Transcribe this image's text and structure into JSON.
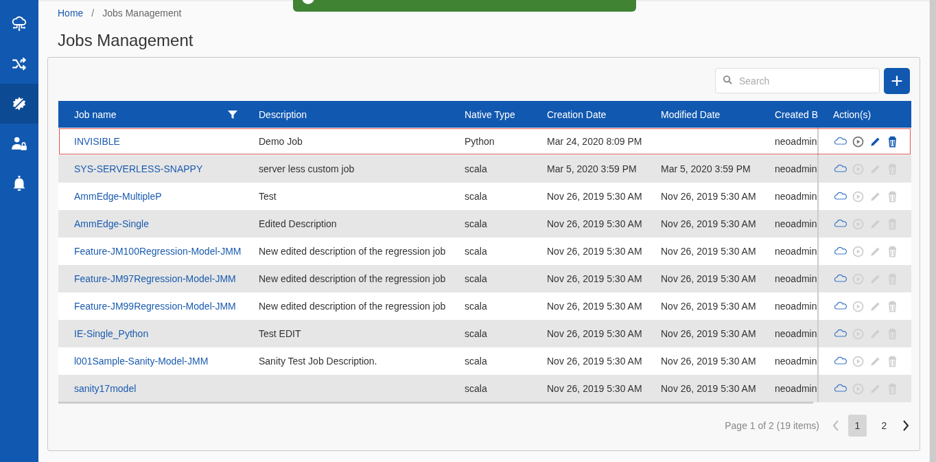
{
  "sidebar": {
    "items": [
      {
        "kind": "cloud",
        "selected": false
      },
      {
        "kind": "shuffle",
        "selected": false
      },
      {
        "kind": "gear",
        "selected": true
      },
      {
        "kind": "user-lock",
        "selected": false
      },
      {
        "kind": "bell",
        "selected": false
      }
    ]
  },
  "breadcrumb": [
    {
      "label": "Home",
      "link": true
    },
    {
      "label": "Jobs Management",
      "link": false
    }
  ],
  "breadcrumb_separator": "/",
  "title": "Jobs Management",
  "search": {
    "placeholder": "Search"
  },
  "add_button": "+",
  "table": {
    "columns": [
      {
        "label": "Job name",
        "filter": true
      },
      {
        "label": "Description",
        "filter": false
      },
      {
        "label": "Native Type",
        "filter": false
      },
      {
        "label": "Creation Date",
        "filter": false
      },
      {
        "label": "Modified Date",
        "filter": false
      },
      {
        "label": "Created B",
        "filter": false
      },
      {
        "label": "Action(s)",
        "filter": false
      }
    ],
    "rows": [
      {
        "name": "INVISIBLE",
        "description": "Demo Job",
        "type": "Python",
        "created": "Mar 24, 2020 8:09 PM",
        "modified": "",
        "created_by": "neoadmin",
        "selected": true,
        "actions_enabled": true
      },
      {
        "name": "SYS-SERVERLESS-SNAPPY",
        "description": "server less custom job",
        "type": "scala",
        "created": "Mar 5, 2020 3:59 PM",
        "modified": "Mar 5, 2020 3:59 PM",
        "created_by": "neoadmin",
        "selected": false,
        "actions_enabled": false
      },
      {
        "name": "AmmEdge-MultipleP",
        "description": "Test",
        "type": "scala",
        "created": "Nov 26, 2019 5:30 AM",
        "modified": "Nov 26, 2019 5:30 AM",
        "created_by": "neoadmin",
        "selected": false,
        "actions_enabled": false
      },
      {
        "name": "AmmEdge-Single",
        "description": "Edited Description",
        "type": "scala",
        "created": "Nov 26, 2019 5:30 AM",
        "modified": "Nov 26, 2019 5:30 AM",
        "created_by": "neoadmin",
        "selected": false,
        "actions_enabled": false
      },
      {
        "name": "Feature-JM100Regression-Model-JMM",
        "description": "New edited description of the regression job",
        "type": "scala",
        "created": "Nov 26, 2019 5:30 AM",
        "modified": "Nov 26, 2019 5:30 AM",
        "created_by": "neoadmin",
        "selected": false,
        "actions_enabled": false
      },
      {
        "name": "Feature-JM97Regression-Model-JMM",
        "description": "New edited description of the regression job",
        "type": "scala",
        "created": "Nov 26, 2019 5:30 AM",
        "modified": "Nov 26, 2019 5:30 AM",
        "created_by": "neoadmin",
        "selected": false,
        "actions_enabled": false
      },
      {
        "name": "Feature-JM99Regression-Model-JMM",
        "description": "New edited description of the regression job",
        "type": "scala",
        "created": "Nov 26, 2019 5:30 AM",
        "modified": "Nov 26, 2019 5:30 AM",
        "created_by": "neoadmin",
        "selected": false,
        "actions_enabled": false
      },
      {
        "name": "IE-Single_Python",
        "description": "Test EDIT",
        "type": "scala",
        "created": "Nov 26, 2019 5:30 AM",
        "modified": "Nov 26, 2019 5:30 AM",
        "created_by": "neoadmin",
        "selected": false,
        "actions_enabled": false
      },
      {
        "name": "l001Sample-Sanity-Model-JMM",
        "description": "Sanity Test Job Description.",
        "type": "scala",
        "created": "Nov 26, 2019 5:30 AM",
        "modified": "Nov 26, 2019 5:30 AM",
        "created_by": "neoadmin",
        "selected": false,
        "actions_enabled": false
      },
      {
        "name": "sanity17model",
        "description": "",
        "type": "scala",
        "created": "Nov 26, 2019 5:30 AM",
        "modified": "Nov 26, 2019 5:30 AM",
        "created_by": "neoadmin",
        "selected": false,
        "actions_enabled": false
      }
    ]
  },
  "pagination": {
    "summary": "Page 1 of 2 (19 items)",
    "prev_enabled": false,
    "next_enabled": true,
    "pages": [
      {
        "label": "1",
        "selected": true
      },
      {
        "label": "2",
        "selected": false
      }
    ]
  }
}
